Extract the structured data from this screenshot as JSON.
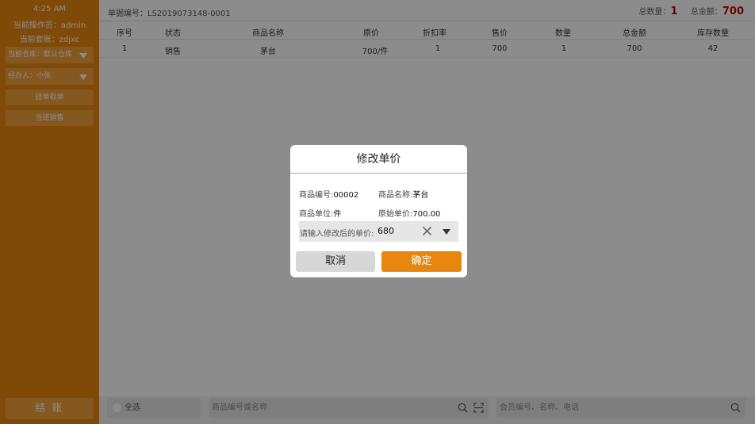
{
  "sidebar": {
    "time": "4:25 AM",
    "operator": "当前操作员：admin",
    "set": "当前套账：zdjxc",
    "warehouse": "当前仓库：默认仓库",
    "handler": "经办人：小张",
    "btn_pending": "挂单取单",
    "btn_today": "当班销售",
    "checkout": "结 账"
  },
  "order": {
    "label": "单据编号：LS2019073148-0001",
    "total_qty_label": "总数量：",
    "total_qty": "1",
    "total_amount_label": "总金额：",
    "total_amount": "700"
  },
  "table": {
    "headers": [
      "序号",
      "状态",
      "商品名称",
      "原价",
      "折扣率",
      "售价",
      "数量",
      "总金额",
      "库存数量"
    ],
    "rows": [
      [
        "1",
        "销售",
        "茅台",
        "700/件",
        "1",
        "700",
        "1",
        "700",
        "42"
      ]
    ]
  },
  "bottom": {
    "select_all": "全选",
    "product_placeholder": "商品编号或名称",
    "member_placeholder": "会员编号、名称、电话"
  },
  "dialog": {
    "title": "修改单价",
    "code_label": "商品编号:",
    "code": "00002",
    "name_label": "商品名称:",
    "name": "茅台",
    "unit_label": "商品单位:",
    "unit": "件",
    "orig_label": "原始单价:",
    "orig": "700.00",
    "input_label": "请输入修改后的单价:",
    "input_value": "680",
    "cancel": "取消",
    "confirm": "确定"
  },
  "colors": {
    "accent": "#e8870f",
    "alert": "#cc0000"
  }
}
